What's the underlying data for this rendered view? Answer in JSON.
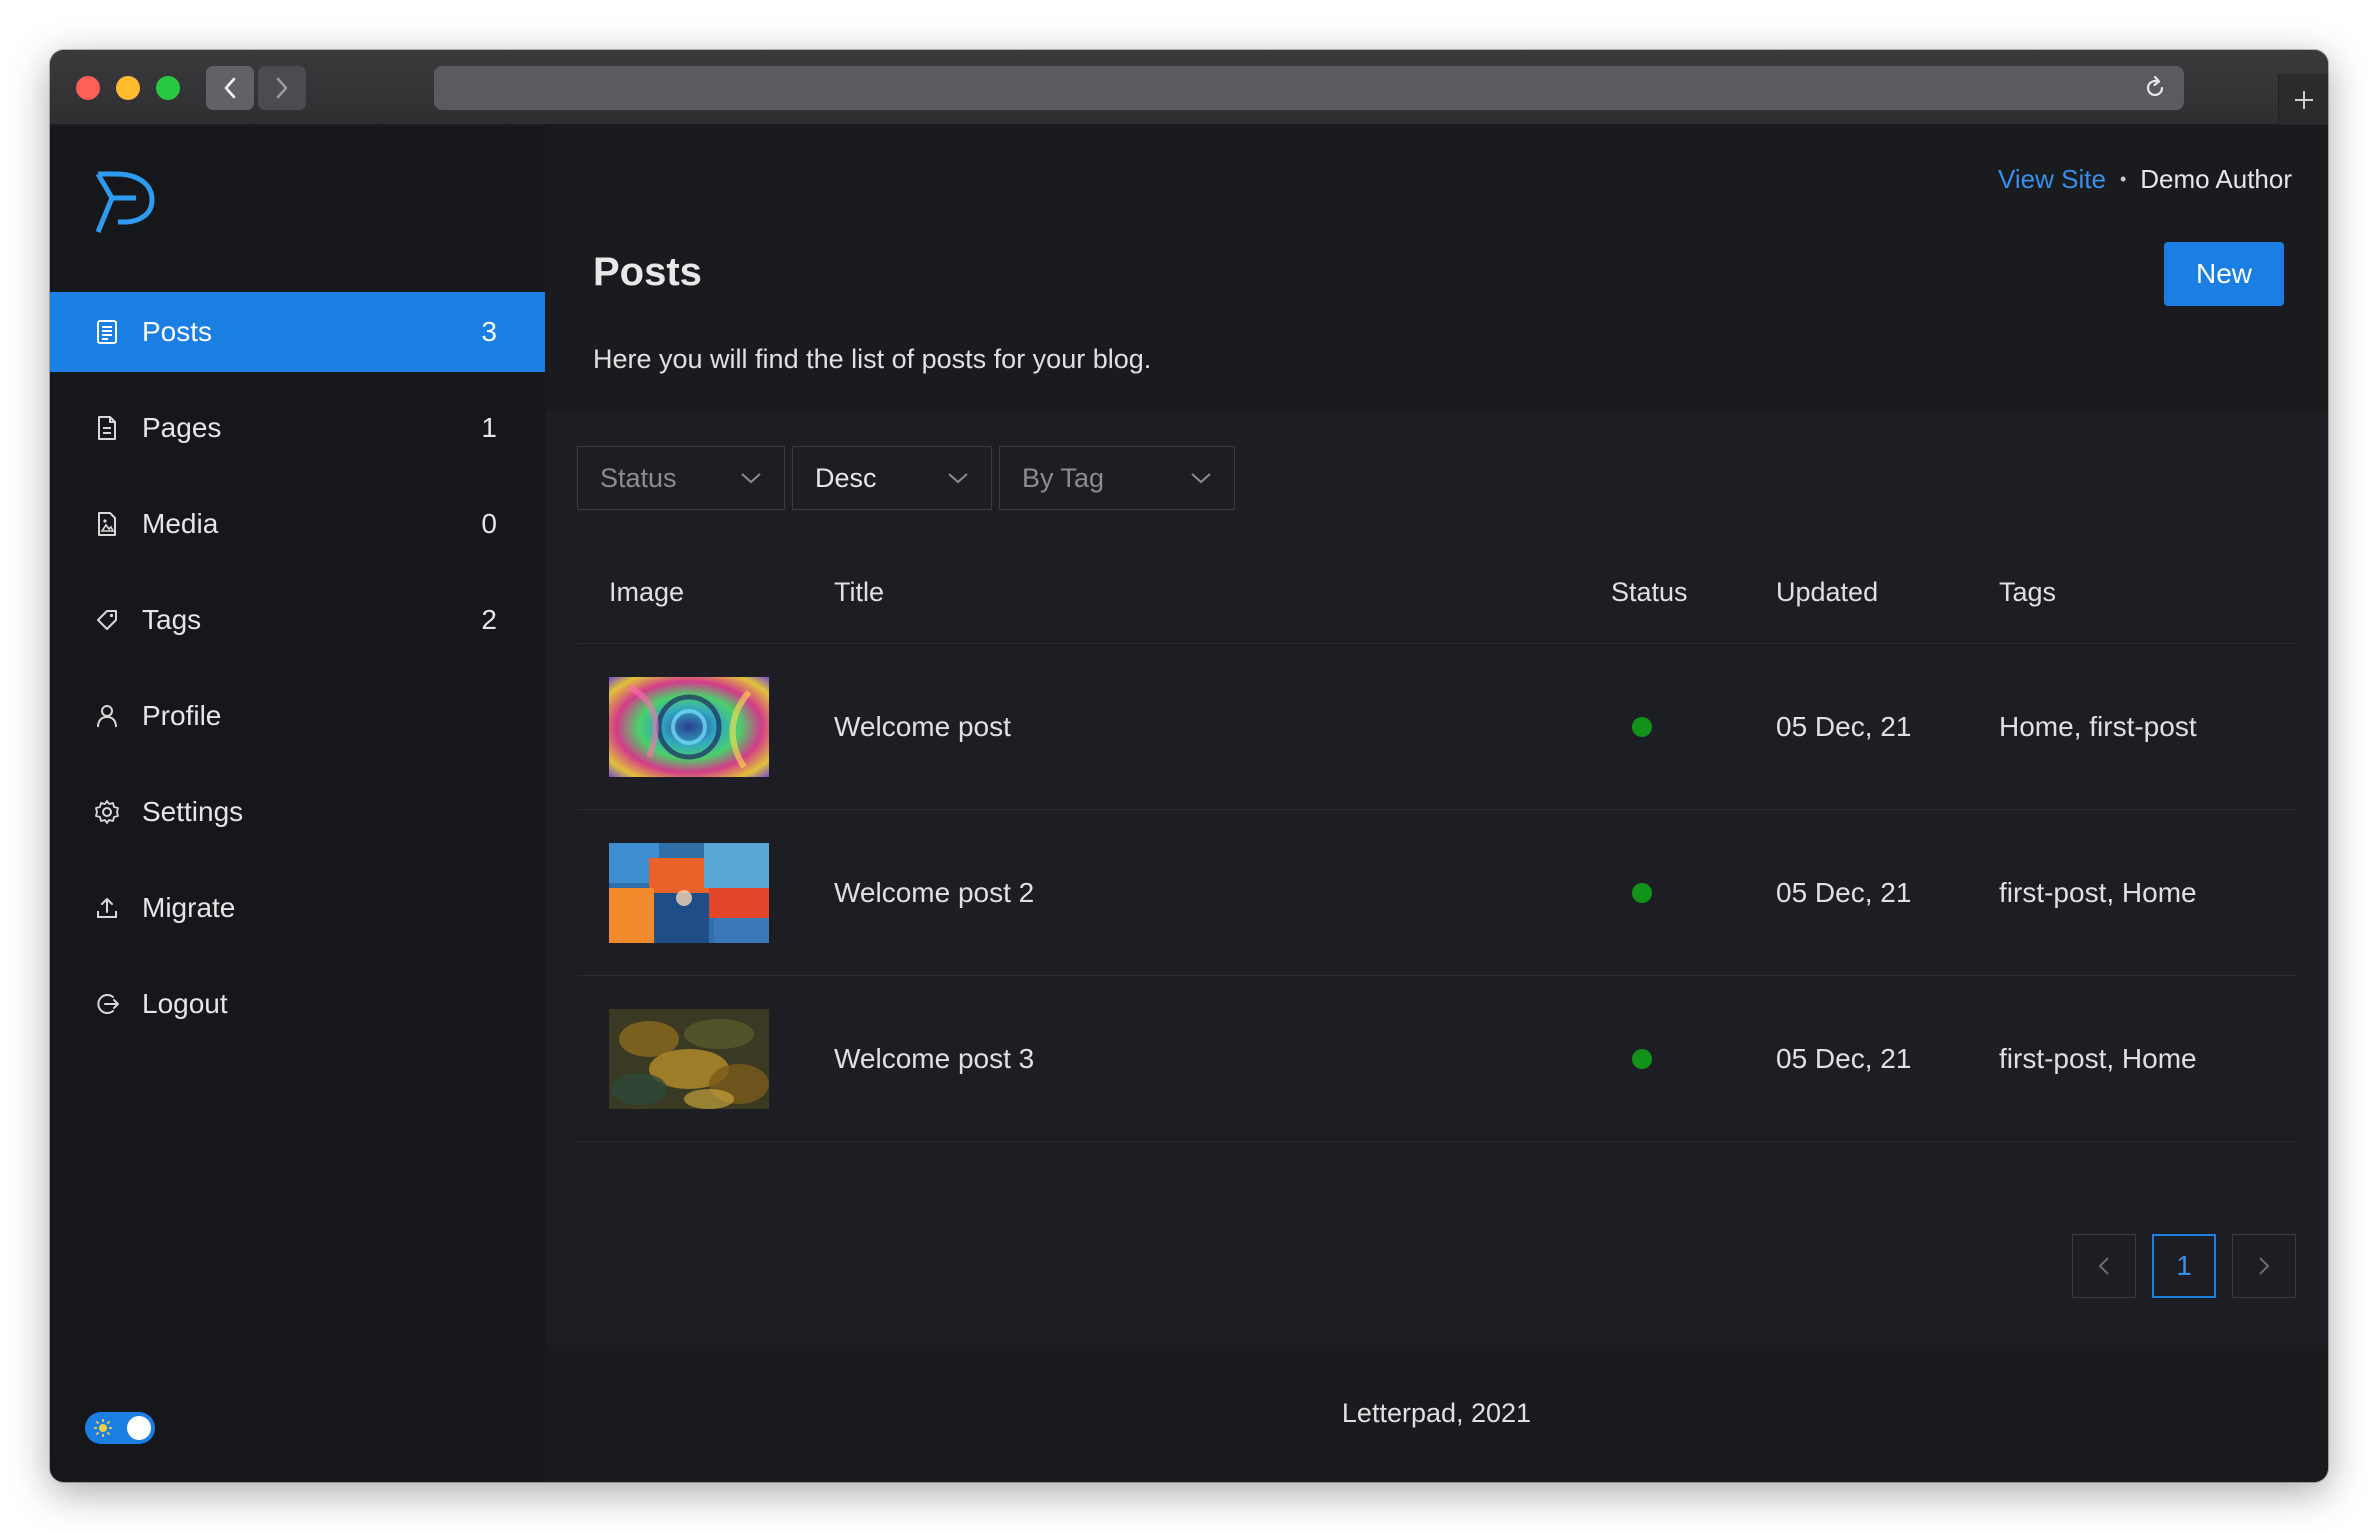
{
  "sidebar": {
    "logo_icon": "letterpad-logo",
    "items": [
      {
        "label": "Posts",
        "count": "3",
        "icon": "posts-icon",
        "active": true
      },
      {
        "label": "Pages",
        "count": "1",
        "icon": "page-icon"
      },
      {
        "label": "Media",
        "count": "0",
        "icon": "media-icon"
      },
      {
        "label": "Tags",
        "count": "2",
        "icon": "tag-icon"
      },
      {
        "label": "Profile",
        "count": "",
        "icon": "user-icon"
      },
      {
        "label": "Settings",
        "count": "",
        "icon": "gear-icon"
      },
      {
        "label": "Migrate",
        "count": "",
        "icon": "upload-icon"
      },
      {
        "label": "Logout",
        "count": "",
        "icon": "logout-icon"
      }
    ],
    "theme_toggle": {
      "state": "dark",
      "icon": "sun-icon"
    }
  },
  "header": {
    "view_site": "View Site",
    "author": "Demo Author"
  },
  "page": {
    "title": "Posts",
    "new_button": "New",
    "description": "Here you will find the list of posts for your blog."
  },
  "filters": {
    "status": "Status",
    "order": "Desc",
    "tag": "By Tag"
  },
  "table": {
    "columns": [
      "Image",
      "Title",
      "Status",
      "Updated",
      "Tags"
    ],
    "rows": [
      {
        "title": "Welcome post",
        "status": "published",
        "updated": "05 Dec, 21",
        "tags": "Home, first-post"
      },
      {
        "title": "Welcome post 2",
        "status": "published",
        "updated": "05 Dec, 21",
        "tags": "first-post, Home"
      },
      {
        "title": "Welcome post 3",
        "status": "published",
        "updated": "05 Dec, 21",
        "tags": "first-post, Home"
      }
    ]
  },
  "pagination": {
    "current": "1"
  },
  "footer": {
    "text": "Letterpad, 2021"
  },
  "colors": {
    "accent": "#1a7ee3",
    "link": "#3a8fe8",
    "status_published": "#13921a",
    "sidebar_bg": "#16171b",
    "main_bg": "#1a1b1f"
  }
}
